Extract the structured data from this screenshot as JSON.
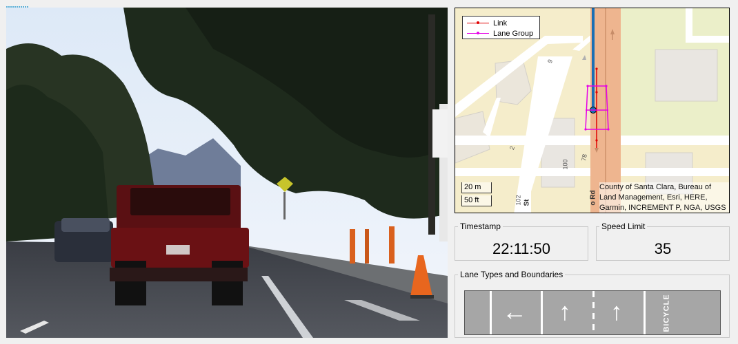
{
  "camera": {
    "description_icon": "camera-frame"
  },
  "map": {
    "legend": [
      {
        "label": "Link",
        "color": "#e00000"
      },
      {
        "label": "Lane Group",
        "color": "#e600e6"
      }
    ],
    "scale_metric": "20 m",
    "scale_imperial": "50 ft",
    "attribution": "County of Santa Clara, Bureau of Land Management, Esri, HERE, Garmin, INCREMENT P, NGA, USGS",
    "street_labels": {
      "st": "St",
      "rd": "o Rd",
      "n102": "102",
      "n100": "100",
      "n78": "78",
      "n2": "2",
      "n9": "9"
    }
  },
  "timestamp": {
    "title": "Timestamp",
    "value": "22:11:50"
  },
  "speed_limit": {
    "title": "Speed Limit",
    "value": "35"
  },
  "lanes": {
    "title": "Lane Types and Boundaries",
    "arrows": [
      "←",
      "↑",
      "↑"
    ],
    "bicycle_label": "BICYCLE"
  },
  "colors": {
    "route": "#1a6fb5",
    "link": "#e00000",
    "lane_group": "#e600e6",
    "road_main": "#eeb58f"
  }
}
